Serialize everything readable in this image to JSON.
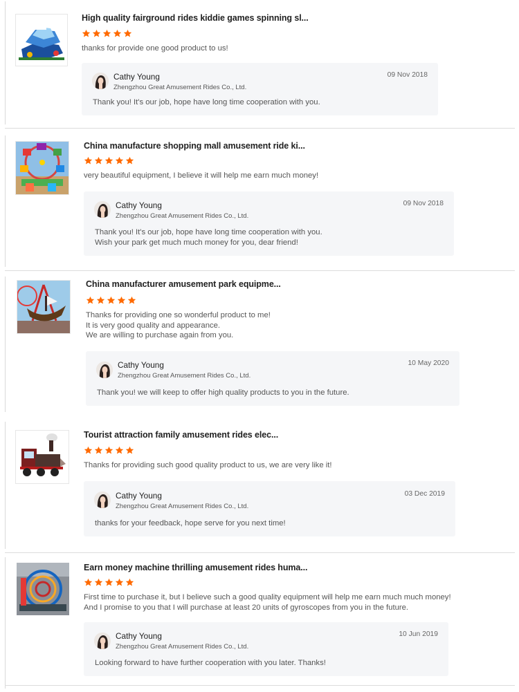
{
  "colors": {
    "star": "#ff6a00",
    "reply_bg": "#f5f6f8",
    "divider": "#dcdcdc"
  },
  "reviews": [
    {
      "product_title": "High quality fairground rides kiddie games spinning sl...",
      "rating": 5,
      "comment": [
        "thanks for provide one good product to us!"
      ],
      "reply": {
        "name": "Cathy Young",
        "company": "Zhengzhou Great Amusement Rides Co., Ltd.",
        "date": "09 Nov 2018",
        "text": [
          "Thank you! It's our job, hope have long time cooperation with you."
        ]
      }
    },
    {
      "product_title": "China manufacture shopping mall amusement ride ki...",
      "rating": 5,
      "comment": [
        "very beautiful equipment, I believe it will help me earn much money!"
      ],
      "reply": {
        "name": "Cathy Young",
        "company": "Zhengzhou Great Amusement Rides Co., Ltd.",
        "date": "09 Nov 2018",
        "text": [
          "Thank you! It's our job, hope have long time cooperation with you.",
          "Wish your park get much much money for you, dear friend!"
        ]
      }
    },
    {
      "product_title": "China manufacturer amusement park equipme...",
      "rating": 5,
      "comment": [
        "Thanks for providing one so wonderful product to me!",
        "It is very good quality and appearance.",
        "We are willing to purchase again from you."
      ],
      "reply": {
        "name": "Cathy Young",
        "company": "Zhengzhou Great Amusement Rides Co., Ltd.",
        "date": "10 May 2020",
        "text": [
          "Thank you! we will keep to offer high quality products to you in the future."
        ]
      }
    },
    {
      "product_title": "Tourist attraction family amusement rides elec...",
      "rating": 5,
      "comment": [
        "Thanks for providing such good quality product to us, we are very like it!"
      ],
      "reply": {
        "name": "Cathy Young",
        "company": "Zhengzhou Great Amusement Rides Co., Ltd.",
        "date": "03 Dec 2019",
        "text": [
          "thanks for your feedback, hope serve for you next time!"
        ]
      }
    },
    {
      "product_title": "Earn money machine thrilling amusement rides huma...",
      "rating": 5,
      "comment": [
        "First time to purchase it, but I believe such a good quality equipment will help me earn much much money!",
        "And I promise to you that I will purchase at least 20 units of gyroscopes from you in the future."
      ],
      "reply": {
        "name": "Cathy Young",
        "company": "Zhengzhou Great Amusement Rides Co., Ltd.",
        "date": "10 Jun 2019",
        "text": [
          "Looking forward to have further cooperation with you later. Thanks!"
        ]
      }
    }
  ]
}
